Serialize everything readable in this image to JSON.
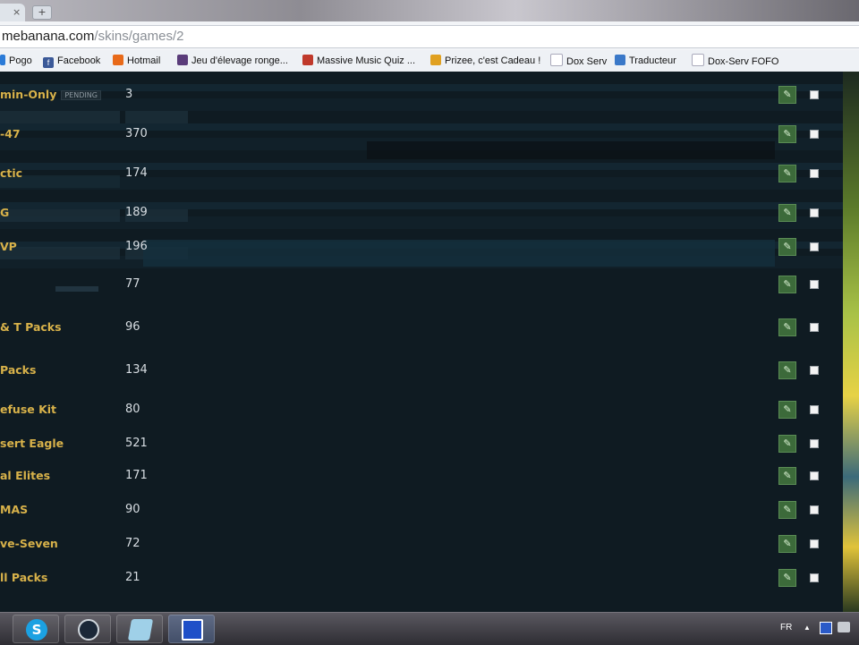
{
  "browser": {
    "tab_close_glyph": "×",
    "new_tab_glyph": "+",
    "url_domain": "mebanana.com",
    "url_path": "/skins/games/2"
  },
  "bookmarks": [
    {
      "label": "Pogo",
      "icon": "pogo-icon",
      "color": "#2b7bd8"
    },
    {
      "label": "Facebook",
      "icon": "facebook-icon",
      "color": "#3b5998"
    },
    {
      "label": "Hotmail",
      "icon": "hotmail-icon",
      "color": "#e86a1a"
    },
    {
      "label": "Jeu d'élevage ronge...",
      "icon": "game-icon",
      "color": "#5a3c7a"
    },
    {
      "label": "Massive Music Quiz ...",
      "icon": "quiz-icon",
      "color": "#c0392b"
    },
    {
      "label": "Prizee, c'est Cadeau !",
      "icon": "gift-icon",
      "color": "#e0a020"
    },
    {
      "label": "Dox Serv",
      "icon": "page-icon",
      "color": "#b8bec6"
    },
    {
      "label": "Traducteur",
      "icon": "translate-icon",
      "color": "#3a78c8"
    },
    {
      "label": "Dox-Serv FOFO",
      "icon": "page-icon",
      "color": "#b8bec6"
    }
  ],
  "rows": [
    {
      "name": "min-Only",
      "badge": "PENDING",
      "count": "3"
    },
    {
      "name": "-47",
      "count": "370"
    },
    {
      "name": "ctic",
      "count": "174"
    },
    {
      "name": "G",
      "count": "189"
    },
    {
      "name": "VP",
      "count": "196"
    },
    {
      "name": "",
      "count": "77"
    },
    {
      "name": "& T Packs",
      "count": "96"
    },
    {
      "name": "Packs",
      "count": "134"
    },
    {
      "name": "efuse Kit",
      "count": "80"
    },
    {
      "name": "sert Eagle",
      "count": "521"
    },
    {
      "name": "al Elites",
      "count": "171"
    },
    {
      "name": "MAS",
      "count": "90"
    },
    {
      "name": "ve-Seven",
      "count": "72"
    },
    {
      "name": "ll Packs",
      "count": "21"
    }
  ],
  "row_actions": {
    "edit_icon": "wrench-icon",
    "edit_glyph": "✎"
  },
  "taskbar": {
    "apps": [
      {
        "name": "skype-icon",
        "color": "#1ba1e2"
      },
      {
        "name": "steam-icon",
        "color": "#1b2838"
      },
      {
        "name": "file-icon",
        "color": "#7fb7d6"
      },
      {
        "name": "app-icon",
        "color": "#1f4fc8"
      }
    ],
    "language": "FR"
  },
  "colors": {
    "page_bg": "#0f1b22",
    "name_gold": "#d8b24a",
    "edit_green": "#3c6a3a"
  }
}
